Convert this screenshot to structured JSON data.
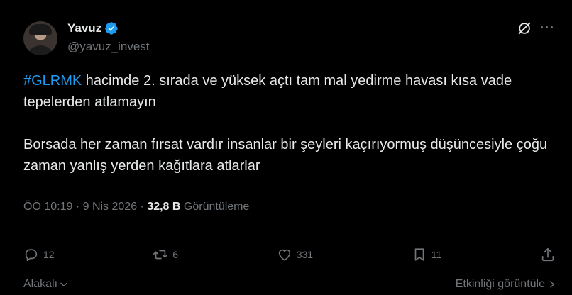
{
  "author": {
    "display_name": "Yavuz",
    "handle": "@yavuz_invest",
    "verified": true
  },
  "tweet": {
    "hashtag": "#GLRMK",
    "line1_rest": " hacimde 2. sırada ve yüksek açtı tam mal yedirme havası kısa vade tepelerden atlamayın",
    "paragraph2": "Borsada her zaman fırsat vardır insanlar bir şeyleri kaçırıyormuş düşüncesiyle çoğu zaman yanlış yerden kağıtlara atlarlar"
  },
  "meta": {
    "time": "ÖÖ 10:19",
    "separator": " · ",
    "date": "9 Nis 2026",
    "views_count": "32,8 B",
    "views_label": " Görüntüleme"
  },
  "actions": {
    "replies": "12",
    "reposts": "6",
    "likes": "331",
    "bookmarks": "11"
  },
  "footer": {
    "related_label": "Alakalı",
    "activity_label": "Etkinliği görüntüle"
  },
  "icons": {
    "more": "more-icon",
    "grok": "grok-icon",
    "verified": "verified-badge-icon"
  },
  "colors": {
    "accent": "#1d9bf0",
    "muted": "#71767b",
    "text": "#e7e9ea",
    "divider": "#2f3336"
  }
}
